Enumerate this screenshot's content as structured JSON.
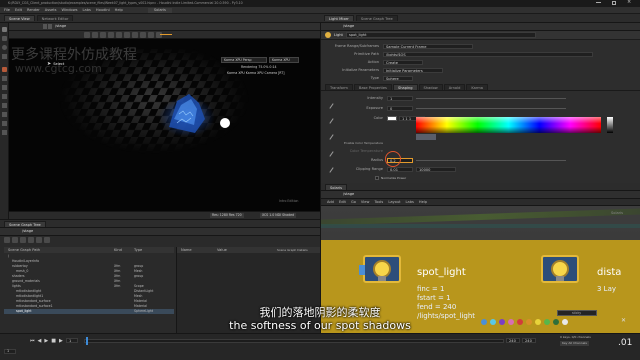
{
  "title_bar": "K:/RDLY_CGS_Client_production/studio/examples/scene_files/Week07_light_types_v002.hipnc - Houdini Indie Limited-Commercial 20.0.590 - Py3.10",
  "menu": [
    "File",
    "Edit",
    "Render",
    "Assets",
    "Windows",
    "Labs",
    "Houdini",
    "Help"
  ],
  "desktop": "Solaris",
  "watermark_cn": "更多课程外仿成教程",
  "watermark_url": "www.cgtcg.com",
  "viewport": {
    "path": "/stage",
    "tool": "Select",
    "camera": "Karma XPU Persp",
    "cam_sub": "Karma XPU",
    "stats": "Rendering   75.0%  0:14",
    "stats2": "Karma XPU   Karma XPU  Camera [RT]",
    "frame_info": "Intro Edition",
    "footer_res": "Res: 1280 Res 720",
    "footer_fps": "XCS 1.0   NDI Shaded"
  },
  "params": {
    "tabs": [
      "Scene View",
      "Network Editor"
    ],
    "path": "/stage",
    "node_type": "Light",
    "node_name": "spot_light",
    "rows": [
      {
        "label": "Primitive Path",
        "value": "/lights/$OS"
      },
      {
        "label": "Action",
        "value": "Create"
      },
      {
        "label": "Initialize Parameters",
        "value": "Initialize Parameters"
      },
      {
        "label": "Type",
        "value": "Sphere"
      }
    ],
    "frame_range_label": "Frame Range/Subframes",
    "frame_range_value": "Sample Current Frame",
    "subtabs": [
      "Transform",
      "Base Properties",
      "Shaping",
      "Shadow",
      "Arnold",
      "Karma"
    ],
    "intensity_label": "Intensity",
    "intensity_value": "1",
    "exposure_label": "Exposure",
    "exposure_value": "0",
    "color_label": "Color",
    "color_value": "1  1  1",
    "use_temp": "Enable Color Temperature",
    "temp_label": "Color Temperature",
    "radius_label": "Radius",
    "radius_value": "0.2",
    "clip_label": "Clipping Range",
    "clip_min": "0.01",
    "clip_max": "10000",
    "normalize": "Normalize Power"
  },
  "network": {
    "tabs": [
      "Light Mixer",
      "Scene Graph Tree",
      "Solaris"
    ],
    "path": "/stage",
    "menu": [
      "Add",
      "Edit",
      "Go",
      "View",
      "Tools",
      "Layout",
      "Labs",
      "Help"
    ],
    "node_label": "spot_light",
    "node_lines": [
      "finc = 1",
      "fstart = 1",
      "fend = 240",
      "/lights/spot_light"
    ],
    "right_node_label": "dista",
    "right_node_sub": "3 Lay",
    "panel_caption": "Solaris",
    "swatch_caption": "sticky"
  },
  "scene_tree": {
    "tab": "Scene Graph Tree",
    "path": "/stage",
    "columns": [
      "Scene Graph Path",
      "Kind",
      "Type"
    ],
    "rows": [
      {
        "name": "/",
        "kind": "",
        "type": ""
      },
      {
        "name": "HoudiniLayerInfo",
        "kind": "",
        "type": ""
      },
      {
        "name": "rubbertoy",
        "kind": "Xfm",
        "type": "group"
      },
      {
        "name": "mesh_0",
        "kind": "Xfm",
        "type": "Mesh"
      },
      {
        "name": "shaders",
        "kind": "Xfm",
        "type": "group"
      },
      {
        "name": "ground_materials",
        "kind": "Xfm",
        "type": ""
      },
      {
        "name": "lights",
        "kind": "Xfm",
        "type": "Scope"
      },
      {
        "name": "mtlxdistantlight",
        "kind": "",
        "type": "DistantLight"
      },
      {
        "name": "mtlxdistantlight1",
        "kind": "",
        "type": "Mesh"
      },
      {
        "name": "mtlxstandard_surface",
        "kind": "",
        "type": "Material"
      },
      {
        "name": "mtlxstandard_surface1",
        "kind": "",
        "type": "Material"
      },
      {
        "name": "spot_light",
        "kind": "",
        "type": "SphereLight"
      }
    ],
    "prim_tabs": [
      "Name",
      "Value"
    ],
    "prim_header": "Scene Graph Details"
  },
  "subtitle": {
    "cn": "我们的落地阴影的柔软度",
    "en": "the softness of our spot shadows"
  },
  "timeline": {
    "start": "1",
    "current": "1",
    "end_a": "240",
    "end_b": "240",
    "keys_label": "0 keys, 0/0 channels",
    "auto_update": "Key All Channels",
    "frame_big": ".01"
  },
  "colors": {
    "accent": "#e39b2c",
    "node_yellow": "#caa51f",
    "swatches": [
      "#4b8fd6",
      "#5ac8e6",
      "#7c3fc5",
      "#d86fb2",
      "#d23b3b",
      "#d88f29",
      "#e8d33a",
      "#57b64a",
      "#2f6e3a",
      "#e8e8e8"
    ]
  }
}
